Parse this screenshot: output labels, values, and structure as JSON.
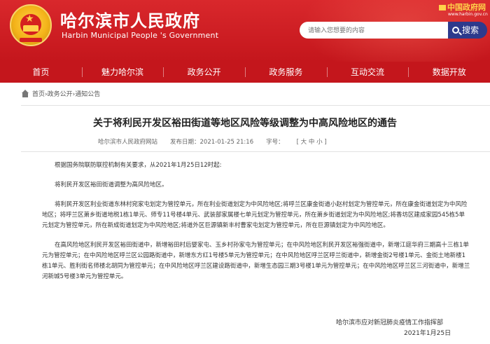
{
  "header": {
    "site_name": "哈尔滨市人民政府",
    "site_name_en": "Harbin Municipal People 's Government",
    "gov_logo_text": "中国政府网",
    "gov_url": "www.harbin.gov.cn",
    "search_placeholder": "请输入您想要的内容",
    "search_button": "搜索"
  },
  "nav": {
    "items": [
      "首页",
      "魅力哈尔滨",
      "政务公开",
      "政务服务",
      "互动交流",
      "数据开放"
    ]
  },
  "breadcrumb": "首页›政务公开›通知公告",
  "article": {
    "title": "关于将利民开发区裕田街道等地区风险等级调整为中高风险地区的通告",
    "source": "哈尔滨市人民政府网站",
    "published": "发布日期：2021-01-25   21:16",
    "font_size_label": "字号：",
    "font_size_options": "[ 大 中 小 ]",
    "paragraphs": [
      "根据国务院联防联控机制有关要求，从2021年1月25日12时起:",
      "将利民开发区裕田街道调整为高风险地区。",
      "将利民开发区利业街道东林村宛家屯划定为管控单元，所在利业街道划定为中风险地区;将呼兰区康金街道小赵村划定为管控单元，所在康金街道划定为中风险地区；将呼兰区萧乡街道地税1栋1单元、师专11号楼4单元、武装部家属楼七单元划定为管控单元，所在萧乡街道划定为中风险地区;将香坊区建成家园545栋5单元划定为管控单元，所在新成街道划定为中风险地区;将道外区巨源镇新丰村曹家屯划定为管控单元，所在巨源镇划定为中风险地区。",
      "在高风险地区利民开发区裕田街道中，新增裕田村后婴家屯、玉乡村孙家屯为管控单元；在中风险地区利民开发区裕强街道中，新增江庭华府三期高十三栋1单元为管控单元；在中风险地区呼兰区公园路街道中，新增东方红1号楼5单元为管控单元；在中风险地区呼兰区呼兰街道中，新增金街2号楼1单元、金街土地新楼1栋1单元、胜利街名师楼北胡同为管控单元；在中风险地区呼兰区建设路街道中，新增生态园三期3号楼1单元为管控单元；在中风险地区呼兰区三河街道中，新增兰河新城5号楼3单元为管控单元。"
    ],
    "signature": "哈尔滨市应对新冠肺炎疫情工作指挥部",
    "date": "2021年1月25日"
  }
}
